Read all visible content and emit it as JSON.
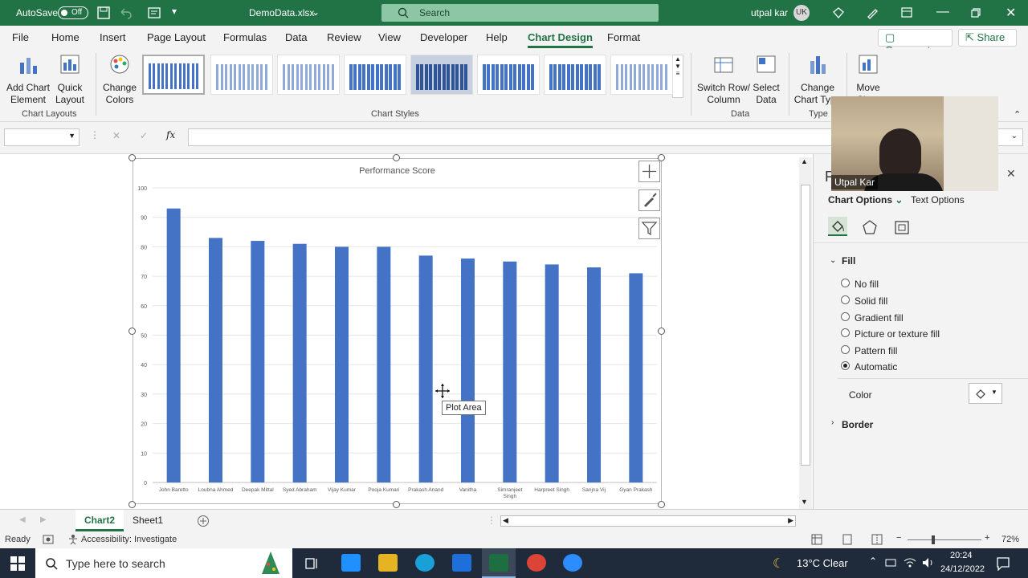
{
  "titlebar": {
    "autosave_label": "AutoSave",
    "autosave_state": "Off",
    "filename": "DemoData.xlsx",
    "search_placeholder": "Search",
    "user_name": "utpal kar",
    "user_initials": "UK"
  },
  "menu": {
    "items": [
      "File",
      "Home",
      "Insert",
      "Page Layout",
      "Formulas",
      "Data",
      "Review",
      "View",
      "Developer",
      "Help",
      "Chart Design",
      "Format"
    ],
    "active": "Chart Design",
    "comments_label": "Comments",
    "share_label": "Share"
  },
  "ribbon": {
    "add_chart_element": "Add Chart Element",
    "quick_layout": "Quick Layout",
    "change_colors": "Change Colors",
    "chart_layouts_group": "Chart Layouts",
    "chart_styles_group": "Chart Styles",
    "switch_row_column": "Switch Row/ Column",
    "select_data": "Select Data",
    "data_group": "Data",
    "change_chart_type": "Change Chart Type",
    "type_group": "Type",
    "move_chart": "Move Chart"
  },
  "formula_bar": {
    "fx_label": "fx"
  },
  "chart_data": {
    "type": "bar",
    "title": "Performance Score",
    "categories": [
      "John Baretto",
      "Loubna Ahmed",
      "Deepak Mittal",
      "Syed Abraham",
      "Vijay Kumar",
      "Pooja Kumari",
      "Prakash Anand",
      "Vanitha",
      "Simranjeet Singh",
      "Harpreet Singh",
      "Sanjna Vij",
      "Gyan Prakash"
    ],
    "values": [
      93,
      83,
      82,
      81,
      80,
      80,
      77,
      76,
      75,
      74,
      73,
      71
    ],
    "ylim": [
      0,
      100
    ],
    "yticks": [
      "0",
      "10",
      "20",
      "30",
      "40",
      "50",
      "60",
      "70",
      "80",
      "90",
      "100"
    ],
    "grid": true,
    "bar_color": "#4472c4"
  },
  "tooltip": "Plot Area",
  "pane": {
    "title": "F",
    "chart_options_label": "Chart Options",
    "text_options_label": "Text Options",
    "fill_section": "Fill",
    "fill_options": [
      "No fill",
      "Solid fill",
      "Gradient fill",
      "Picture or texture fill",
      "Pattern fill",
      "Automatic"
    ],
    "selected_fill": "Automatic",
    "color_label": "Color",
    "border_section": "Border"
  },
  "webcam": {
    "name": "Utpal Kar"
  },
  "sheet_tabs": {
    "tabs": [
      "Chart2",
      "Sheet1"
    ],
    "active": "Chart2"
  },
  "status": {
    "ready": "Ready",
    "accessibility": "Accessibility: Investigate",
    "zoom": "72%"
  },
  "taskbar": {
    "search_placeholder": "Type here to search",
    "weather": "13°C Clear",
    "time": "20:24",
    "date": "24/12/2022"
  }
}
